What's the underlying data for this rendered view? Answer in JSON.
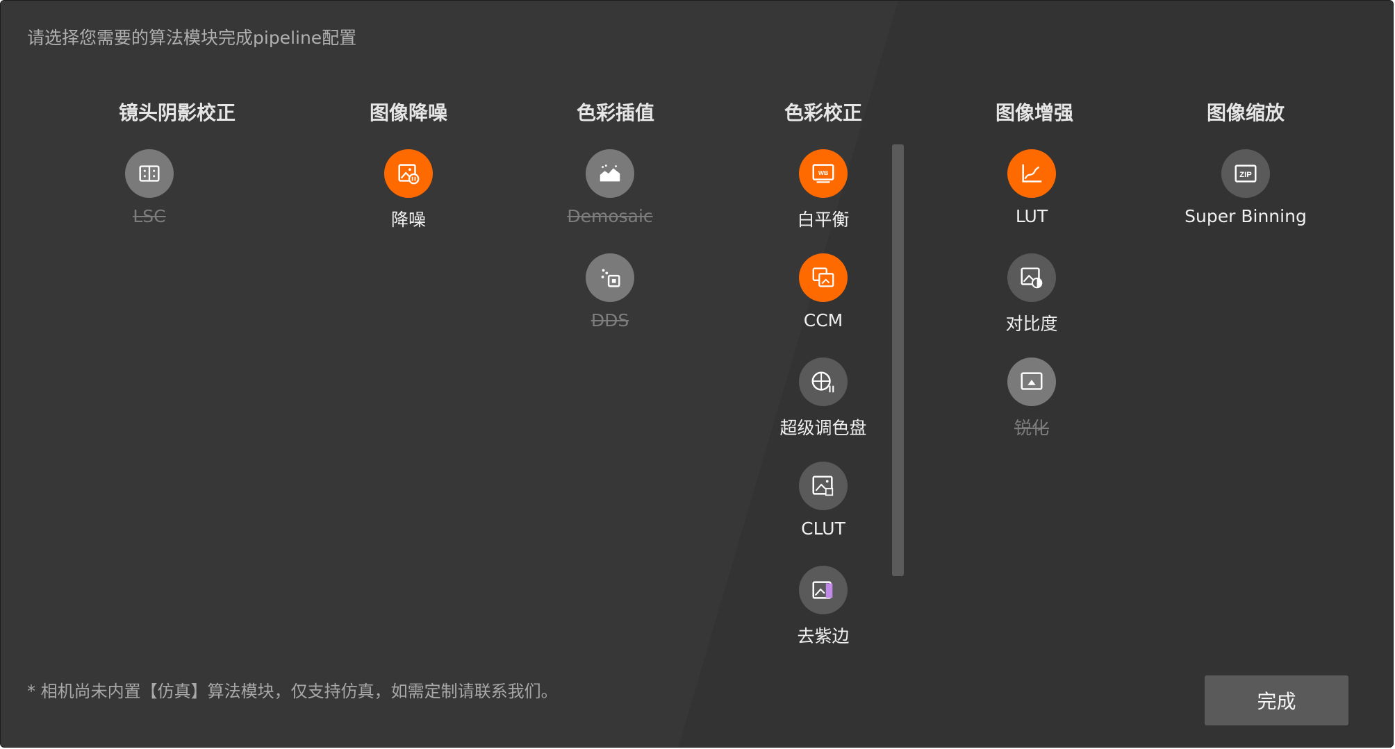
{
  "instruction": "请选择您需要的算法模块完成pipeline配置",
  "columns": [
    {
      "title": "镜头阴影校正",
      "modules": [
        {
          "label": "LSC",
          "icon": "lens-shading-icon",
          "state": "disabled"
        }
      ]
    },
    {
      "title": "图像降噪",
      "modules": [
        {
          "label": "降噪",
          "icon": "denoise-icon",
          "state": "active"
        }
      ]
    },
    {
      "title": "色彩插值",
      "modules": [
        {
          "label": "Demosaic",
          "icon": "demosaic-icon",
          "state": "disabled"
        },
        {
          "label": "DDS",
          "icon": "dds-icon",
          "state": "disabled"
        }
      ]
    },
    {
      "title": "色彩校正",
      "modules": [
        {
          "label": "白平衡",
          "icon": "white-balance-icon",
          "state": "active"
        },
        {
          "label": "CCM",
          "icon": "ccm-icon",
          "state": "active"
        },
        {
          "label": "超级调色盘",
          "icon": "palette-icon",
          "state": "inactive"
        },
        {
          "label": "CLUT",
          "icon": "clut-icon",
          "state": "inactive"
        },
        {
          "label": "去紫边",
          "icon": "purple-fringe-icon",
          "state": "inactive"
        }
      ]
    },
    {
      "title": "图像增强",
      "modules": [
        {
          "label": "LUT",
          "icon": "lut-curve-icon",
          "state": "active"
        },
        {
          "label": "对比度",
          "icon": "contrast-icon",
          "state": "inactive"
        },
        {
          "label": "锐化",
          "icon": "sharpen-icon",
          "state": "disabled"
        }
      ]
    },
    {
      "title": "图像缩放",
      "modules": [
        {
          "label": "Super Binning",
          "icon": "zip-icon",
          "state": "inactive"
        }
      ]
    }
  ],
  "footnote": "* 相机尚未内置【仿真】算法模块，仅支持仿真，如需定制请联系我们。",
  "done_button": "完成",
  "colors": {
    "active": "#ff6a00",
    "inactive": "#5a5a5a",
    "disabled": "#7a7a7a",
    "background": "#353535"
  }
}
